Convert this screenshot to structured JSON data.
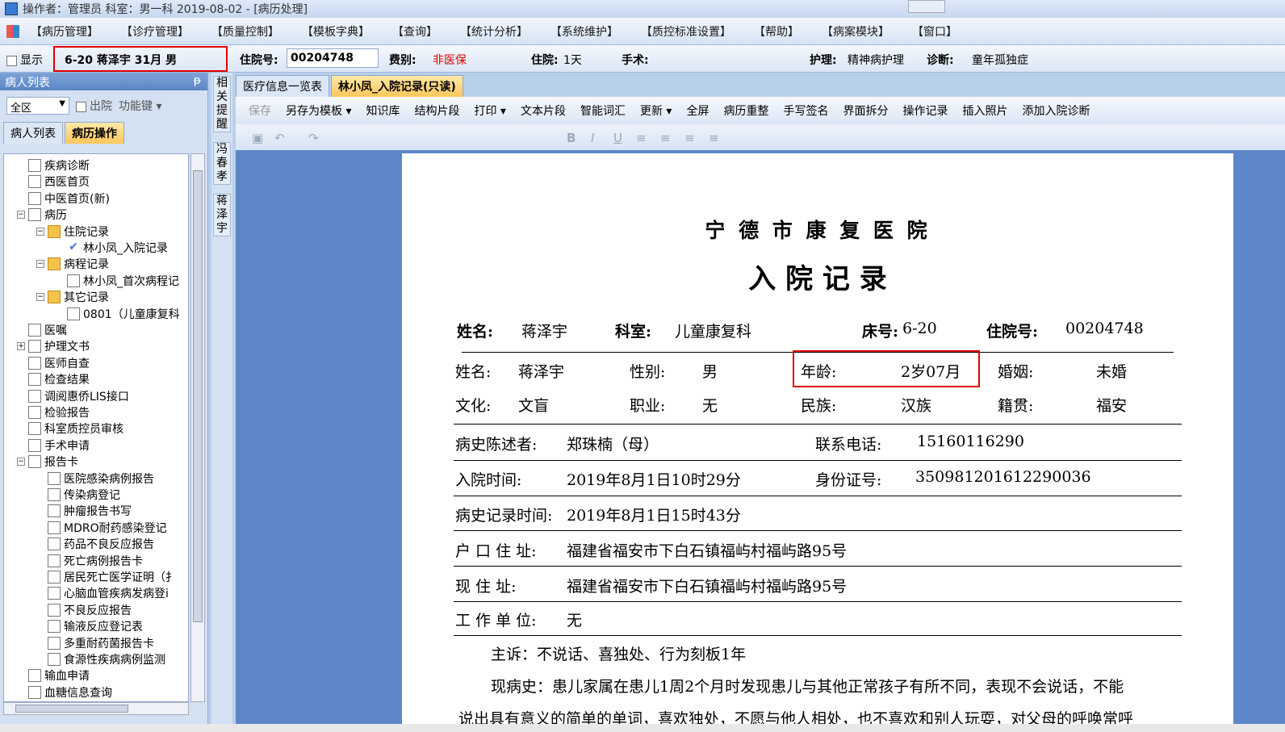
{
  "window": {
    "title": "操作者：管理员  科室：男一科  2019-08-02 - [病历处理]"
  },
  "menu": [
    "【病历管理】",
    "【诊疗管理】",
    "【质量控制】",
    "【模板字典】",
    "【查询】",
    "【统计分析】",
    "【系统维护】",
    "【质控标准设置】",
    "【帮助】",
    "【病案模块】",
    "【窗口】"
  ],
  "infobar": {
    "show_label": "显示",
    "patient_summary": "6-20  蒋泽宇 31月 男",
    "inpatient_no_label": "住院号:",
    "inpatient_no": "00204748",
    "fee_label": "费别:",
    "fee_value": "非医保",
    "stay_label": "住院:",
    "stay_value": "1天",
    "surgery_label": "手术:",
    "nursing_label": "护理:",
    "nursing_value": "精神病护理",
    "diagnosis_label": "诊断:",
    "diagnosis_value": "童年孤独症"
  },
  "left": {
    "header": "病人列表",
    "pin": "ᵽ",
    "filter_value": "全区",
    "discharged_label": "出院",
    "function_key": "功能键",
    "tabs": [
      "病人列表",
      "病历操作"
    ],
    "tree": [
      {
        "label": "疾病诊断",
        "level": 1
      },
      {
        "label": "西医首页",
        "level": 1
      },
      {
        "label": "中医首页(新)",
        "level": 1
      },
      {
        "label": "病历",
        "level": 1,
        "exp": "−"
      },
      {
        "label": "住院记录",
        "level": 2,
        "exp": "−",
        "folder": true
      },
      {
        "label": "林小凤_入院记录",
        "level": 3,
        "check": true
      },
      {
        "label": "病程记录",
        "level": 2,
        "exp": "−",
        "folder": true
      },
      {
        "label": "林小凤_首次病程记",
        "level": 3
      },
      {
        "label": "其它记录",
        "level": 2,
        "exp": "−",
        "folder": true
      },
      {
        "label": "0801（儿童康复科",
        "level": 3
      },
      {
        "label": "医嘱",
        "level": 1
      },
      {
        "label": "护理文书",
        "level": 1,
        "exp": "+"
      },
      {
        "label": "医师自查",
        "level": 1
      },
      {
        "label": "检查结果",
        "level": 1
      },
      {
        "label": "调阅惠侨LIS接口",
        "level": 1
      },
      {
        "label": "检验报告",
        "level": 1
      },
      {
        "label": "科室质控员审核",
        "level": 1
      },
      {
        "label": "手术申请",
        "level": 1
      },
      {
        "label": "报告卡",
        "level": 1,
        "exp": "−"
      },
      {
        "label": "医院感染病例报告",
        "level": 2
      },
      {
        "label": "传染病登记",
        "level": 2
      },
      {
        "label": "肿瘤报告书写",
        "level": 2
      },
      {
        "label": "MDRO耐药感染登记",
        "level": 2
      },
      {
        "label": "药品不良反应报告",
        "level": 2
      },
      {
        "label": "死亡病例报告卡",
        "level": 2
      },
      {
        "label": "居民死亡医学证明（扌",
        "level": 2
      },
      {
        "label": "心脑血管疾病发病登i",
        "level": 2
      },
      {
        "label": "不良反应报告",
        "level": 2
      },
      {
        "label": "输液反应登记表",
        "level": 2
      },
      {
        "label": "多重耐药菌报告卡",
        "level": 2
      },
      {
        "label": "食源性疾病病例监测",
        "level": 2
      },
      {
        "label": "输血申请",
        "level": 1
      },
      {
        "label": "血糖信息查询",
        "level": 1
      }
    ]
  },
  "side": {
    "tab1": "相关提醒",
    "tab2": "冯春孝",
    "tab3": "蒋泽宇"
  },
  "doc_tabs": [
    "医疗信息一览表",
    "林小凤_入院记录(只读)"
  ],
  "toolbar": [
    "保存",
    "另存为模板 ▾",
    "知识库",
    "结构片段",
    "打印 ▾",
    "文本片段",
    "智能词汇",
    "更新 ▾",
    "全屏",
    "病历重整",
    "手写签名",
    "界面拆分",
    "操作记录",
    "插入照片",
    "添加入院诊断"
  ],
  "doc": {
    "hospital": "宁 德 市 康 复 医 院",
    "title": "入   院   记   录",
    "h_name_label": "姓名:",
    "h_name": "蒋泽宇",
    "h_dept_label": "科室:",
    "h_dept": "儿童康复科",
    "h_bed_label": "床号:",
    "h_bed": "6-20",
    "h_inp_label": "住院号:",
    "h_inp": "00204748",
    "name_label": "姓名:",
    "name": "蒋泽宇",
    "sex_label": "性别:",
    "sex": "男",
    "age_label": "年龄:",
    "age": "2岁07月",
    "marriage_label": "婚姻:",
    "marriage": "未婚",
    "edu_label": "文化:",
    "edu": "文盲",
    "job_label": "职业:",
    "job": "无",
    "ethnic_label": "民族:",
    "ethnic": "汉族",
    "native_label": "籍贯:",
    "native": "福安",
    "narrator_label": "病史陈述者:",
    "narrator": "郑珠楠（母）",
    "phone_label": "联系电话:",
    "phone": "15160116290",
    "admit_label": "入院时间:",
    "admit": "2019年8月1日10时29分",
    "id_label": "身份证号:",
    "id": "350981201612290036",
    "record_time_label": "病史记录时间:",
    "record_time": "2019年8月1日15时43分",
    "hukou_label": "户 口 住 址:",
    "hukou": "福建省福安市下白石镇福屿村福屿路95号",
    "current_label": "现    住    址:",
    "current": "福建省福安市下白石镇福屿村福屿路95号",
    "work_label": "工 作 单 位:",
    "work": "无",
    "complaint": "主诉：不说话、喜独处、行为刻板1年",
    "history": "现病史：患儿家属在患儿1周2个月时发现患儿与其他正常孩子有所不同，表现不会说话，不能",
    "history2": "说出具有意义的简单的单词，喜欢独处，不愿与他人相处，也不喜欢和别人玩耍，对父母的呼唤常呼"
  },
  "colors": {
    "highlight_box": "#e00000",
    "fee_color": "#e00000",
    "doc_bg": "#5d86c8"
  }
}
